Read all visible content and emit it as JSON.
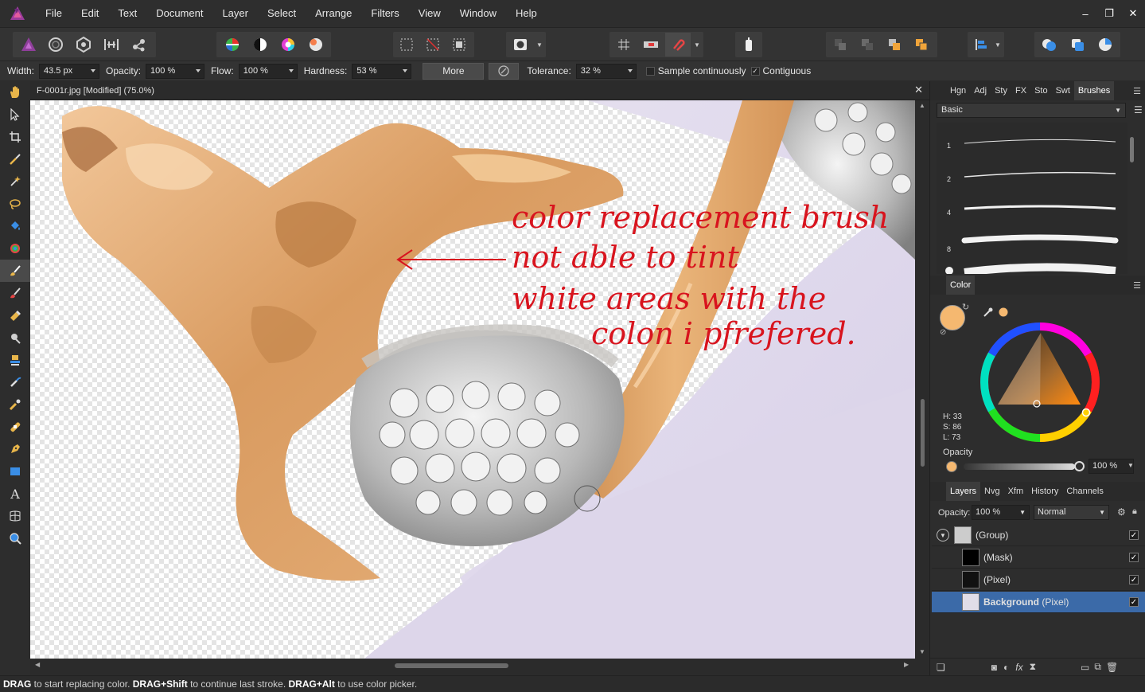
{
  "menu": [
    "File",
    "Edit",
    "Text",
    "Document",
    "Layer",
    "Select",
    "Arrange",
    "Filters",
    "View",
    "Window",
    "Help"
  ],
  "window_controls": {
    "minimize": "–",
    "restore": "❐",
    "close": "✕"
  },
  "context": {
    "width_label": "Width:",
    "width_value": "43.5 px",
    "opacity_label": "Opacity:",
    "opacity_value": "100 %",
    "flow_label": "Flow:",
    "flow_value": "100 %",
    "hardness_label": "Hardness:",
    "hardness_value": "53 %",
    "more_label": "More",
    "tolerance_label": "Tolerance:",
    "tolerance_value": "32 %",
    "sample_label": "Sample continuously",
    "sample_checked": false,
    "contiguous_label": "Contiguous",
    "contiguous_checked": true
  },
  "document": {
    "title": "F-0001r.jpg [Modified] (75.0%)",
    "annotation_lines": [
      "color replacement brush",
      "not able to tint",
      "white areas with the",
      "colon i pfrefered."
    ]
  },
  "status": {
    "k1": "DRAG",
    "t1": " to start replacing color. ",
    "k2": "DRAG+Shift",
    "t2": " to continue last stroke. ",
    "k3": "DRAG+Alt",
    "t3": " to use color picker."
  },
  "studio_top": {
    "tabs": [
      "Hgn",
      "Adj",
      "Sty",
      "FX",
      "Sto",
      "Swt",
      "Brushes"
    ],
    "active": "Brushes",
    "preset": "Basic",
    "brush_sizes": [
      "1",
      "2",
      "4",
      "8"
    ]
  },
  "color_panel": {
    "title": "Color",
    "h": "H: 33",
    "s": "S: 86",
    "l": "L: 73",
    "opacity_label": "Opacity",
    "opacity_value": "100 %",
    "primary_color": "#f5b870",
    "secondary_color": "#111111"
  },
  "layers_panel": {
    "tabs": [
      "Layers",
      "Nvg",
      "Xfm",
      "History",
      "Channels"
    ],
    "opacity_label": "Opacity:",
    "opacity_value": "100 %",
    "blend_mode": "Normal",
    "layers": [
      {
        "name": "(Group)"
      },
      {
        "name": "(Mask)"
      },
      {
        "name": "(Pixel)"
      },
      {
        "name_bold": "Background",
        "name_suffix": " (Pixel)"
      }
    ]
  },
  "colors": {
    "accent_selection": "#3b6aa8",
    "annotation_ink": "#d8141e",
    "gold": "#d9a066"
  }
}
